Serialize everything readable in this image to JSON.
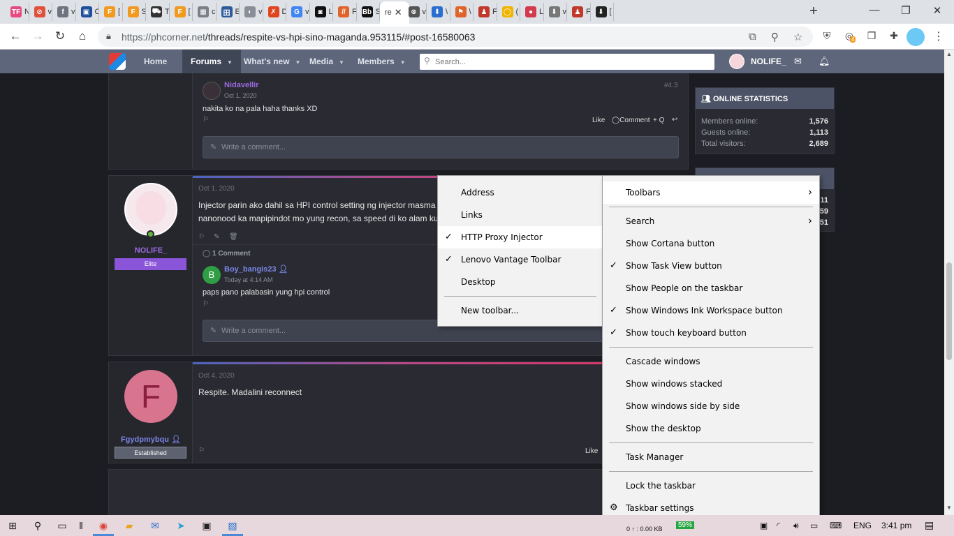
{
  "browser": {
    "tabs": [
      {
        "favicon": "TF",
        "color": "#e84a7f",
        "label": "N"
      },
      {
        "favicon": "⊘",
        "color": "#e0513c",
        "label": "v"
      },
      {
        "favicon": "f",
        "color": "#6f7480",
        "label": "v"
      },
      {
        "favicon": "▣",
        "color": "#1d4f9c",
        "label": "C"
      },
      {
        "favicon": "F",
        "color": "#f29a1f",
        "label": "["
      },
      {
        "favicon": "F",
        "color": "#f29a1f",
        "label": "S"
      },
      {
        "favicon": "⛟",
        "color": "#333333",
        "label": "T"
      },
      {
        "favicon": "F",
        "color": "#f29a1f",
        "label": "["
      },
      {
        "favicon": "▦",
        "color": "#7b7f87",
        "label": "c"
      },
      {
        "favicon": "田",
        "color": "#2e5b9b",
        "label": "E"
      },
      {
        "favicon": "◐",
        "color": "#8a8e96",
        "label": "v"
      },
      {
        "favicon": "✗",
        "color": "#e0451f",
        "label": "D"
      },
      {
        "favicon": "G",
        "color": "#4285f4",
        "label": "v"
      },
      {
        "favicon": "◙",
        "color": "#111111",
        "label": "L"
      },
      {
        "favicon": "//",
        "color": "#e0632a",
        "label": "F"
      },
      {
        "favicon": "Bb",
        "color": "#111111",
        "label": "S"
      },
      {
        "favicon": "",
        "color": "#ffffff",
        "label": "re"
      },
      {
        "favicon": "⊗",
        "color": "#555555",
        "label": "v"
      },
      {
        "favicon": "⬇",
        "color": "#2a6fd0",
        "label": "\\"
      },
      {
        "favicon": "⚑",
        "color": "#e0632a",
        "label": "\\"
      },
      {
        "favicon": "♟",
        "color": "#c0392b",
        "label": "F"
      },
      {
        "favicon": "◯",
        "color": "#f0b400",
        "label": "("
      },
      {
        "favicon": "●",
        "color": "#d33a4d",
        "label": "L"
      },
      {
        "favicon": "⬇",
        "color": "#777777",
        "label": "v"
      },
      {
        "favicon": "♟",
        "color": "#c0392b",
        "label": "F"
      },
      {
        "favicon": "⬇",
        "color": "#222222",
        "label": "["
      }
    ],
    "active_tab_close": "✕",
    "new_tab": "+",
    "window_controls": {
      "minimize": "—",
      "maximize": "❐",
      "close": "✕"
    },
    "url_host": "https://phcorner.net",
    "url_path": "/threads/respite-vs-hpi-sino-maganda.953115/#post-16580063",
    "ext_badge": "4"
  },
  "forum": {
    "nav": {
      "home": "Home",
      "forums": "Forums",
      "whats_new": "What's new",
      "media": "Media",
      "members": "Members"
    },
    "search_placeholder": "Search...",
    "username": "NOLIFE_"
  },
  "posts": {
    "p1": {
      "comment_user": "Nidavellir",
      "comment_time": "Oct 1, 2020",
      "comment_text": "nakita ko na pala haha thanks XD",
      "post_num": "#4.3",
      "like": "Like",
      "comment": "Comment",
      "quote": "+ Q",
      "write_comment": "Write a comment..."
    },
    "p2": {
      "date": "Oct 1, 2020",
      "body_line1": "Injector parin ako dahil sa HPI control setting ng injector masma",
      "body_line2": "nanonood ka mapipindot mo yung recon, sa speed di ko alam ku",
      "user": "NOLIFE_",
      "rank": "Elite",
      "comments_count": "1 Comment",
      "comment_user": "Boy_bangis23",
      "comment_avatar": "B",
      "comment_time": "Today at 4:14 AM",
      "comment_text": "paps pano palabasin yung hpi control",
      "write_comment": "Write a comment..."
    },
    "p3": {
      "date": "Oct 4, 2020",
      "body": "Respite. Madalini reconnect",
      "avatar_letter": "F",
      "user": "Fgydpmybqu",
      "rank": "Established",
      "like": "Like"
    }
  },
  "sidebar": {
    "online_title": "ONLINE STATISTICS",
    "members_label": "Members online:",
    "members_value": "1,576",
    "guests_label": "Guests online:",
    "guests_value": "1,113",
    "total_label": "Total visitors:",
    "total_value": "2,689",
    "partial_values": [
      "11",
      "59",
      "51"
    ]
  },
  "toolbars_menu": {
    "items": [
      "Address",
      "Links",
      "HTTP Proxy Injector",
      "Lenovo Vantage Toolbar",
      "Desktop"
    ],
    "new_toolbar": "New toolbar..."
  },
  "taskbar_menu": {
    "toolbars": "Toolbars",
    "search": "Search",
    "cortana": "Show Cortana button",
    "task_view": "Show Task View button",
    "people": "Show People on the taskbar",
    "ink": "Show Windows Ink Workspace button",
    "touch_kb": "Show touch keyboard button",
    "cascade": "Cascade windows",
    "stacked": "Show windows stacked",
    "side_by_side": "Show windows side by side",
    "desktop": "Show the desktop",
    "task_manager": "Task Manager",
    "lock": "Lock the taskbar",
    "settings": "Taskbar settings"
  },
  "taskbar": {
    "lang": "ENG",
    "time": "3:41 pm",
    "net_speed": "0 ↑ : 0.00 KB",
    "battery": "59%"
  }
}
